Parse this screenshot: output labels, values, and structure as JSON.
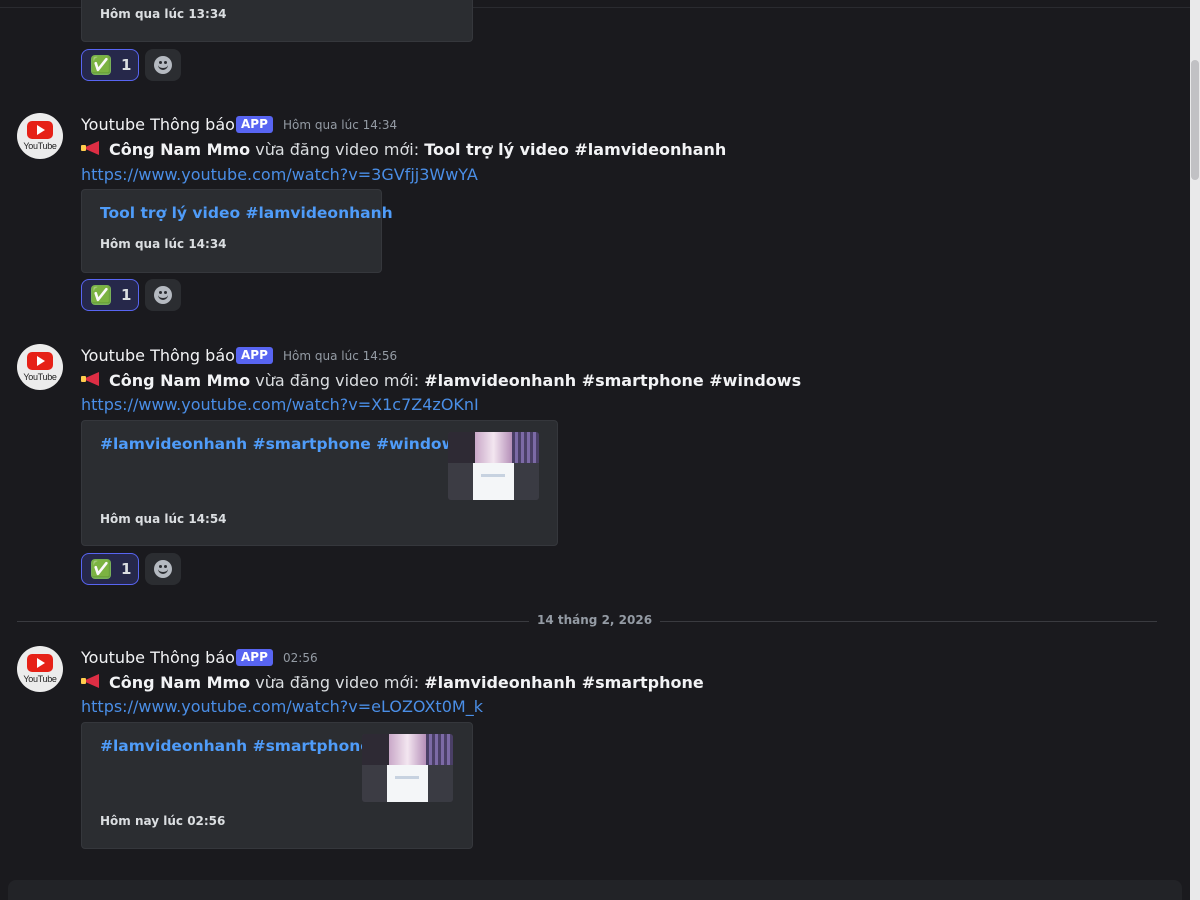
{
  "colors": {
    "background": "#1a1a1e",
    "embed_bg": "#2b2d31",
    "link": "#4a8ee6",
    "embed_title": "#4f9cf9",
    "app_badge": "#5865f2",
    "reaction_border": "#5865f2"
  },
  "top_embed": {
    "footer": "Hôm qua lúc 13:34"
  },
  "top_reaction": {
    "emoji": "✅",
    "count": "1",
    "icon": "white-check-mark-icon"
  },
  "messages": [
    {
      "author": "Youtube Thông báo",
      "badge": "APP",
      "timestamp": "Hôm qua lúc 14:34",
      "icon": "megaphone-icon",
      "channel": "Công Nam Mmo",
      "action": " vừa đăng video mới: ",
      "video_title": "Tool trợ lý video #lamvideonhanh",
      "url": "https://www.youtube.com/watch?v=3GVfjj3WwYA",
      "embed_title": "Tool trợ lý video #lamvideonhanh",
      "embed_footer": "Hôm qua lúc 14:34",
      "reaction_emoji": "✅",
      "reaction_count": "1"
    },
    {
      "author": "Youtube Thông báo",
      "badge": "APP",
      "timestamp": "Hôm qua lúc 14:56",
      "icon": "megaphone-icon",
      "channel": "Công Nam Mmo",
      "action": " vừa đăng video mới: ",
      "video_title": "#lamvideonhanh #smartphone #windows",
      "url": "https://www.youtube.com/watch?v=X1c7Z4zOKnI",
      "embed_title": "#lamvideonhanh #smartphone #windows",
      "embed_footer": "Hôm qua lúc 14:54",
      "reaction_emoji": "✅",
      "reaction_count": "1"
    },
    {
      "author": "Youtube Thông báo",
      "badge": "APP",
      "timestamp": "02:56",
      "icon": "megaphone-icon",
      "channel": "Công Nam Mmo",
      "action": " vừa đăng video mới: ",
      "video_title": "#lamvideonhanh #smartphone",
      "url": "https://www.youtube.com/watch?v=eLOZOXt0M_k",
      "embed_title": "#lamvideonhanh #smartphone",
      "embed_footer": "Hôm nay lúc 02:56"
    }
  ],
  "date_divider": "14 tháng 2, 2026",
  "avatar_text": "YouTube"
}
